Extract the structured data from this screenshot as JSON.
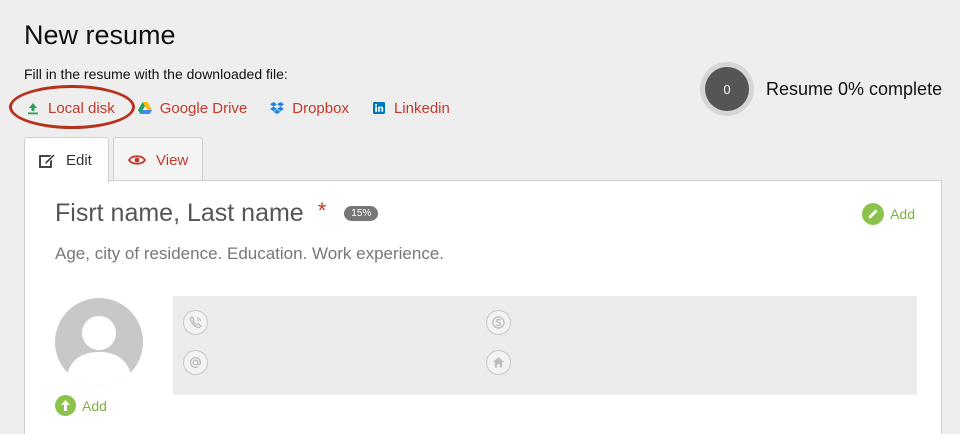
{
  "header": {
    "title": "New resume",
    "subtitle": "Fill in the resume with the downloaded file:"
  },
  "sources": [
    {
      "label": "Local disk",
      "icon": "upload-icon",
      "color": "#2e9e5b"
    },
    {
      "label": "Google Drive",
      "icon": "google-drive-icon"
    },
    {
      "label": "Dropbox",
      "icon": "dropbox-icon",
      "color": "#1e88e5"
    },
    {
      "label": "Linkedin",
      "icon": "linkedin-icon",
      "color": "#0077b5"
    }
  ],
  "progress": {
    "value": "0",
    "label": "Resume 0% complete"
  },
  "tabs": [
    {
      "label": "Edit",
      "icon": "edit-icon",
      "active": true
    },
    {
      "label": "View",
      "icon": "eye-icon",
      "active": false
    }
  ],
  "card": {
    "name_placeholder": "Fisrt name, Last name",
    "required_mark": "*",
    "percent_badge": "15%",
    "add_label": "Add",
    "description": "Age, city of residence. Education. Work experience.",
    "add_photo_label": "Add"
  },
  "contacts": [
    {
      "icon": "phone-icon"
    },
    {
      "icon": "skype-icon"
    },
    {
      "icon": "email-icon"
    },
    {
      "icon": "home-icon"
    }
  ],
  "colors": {
    "accent_red": "#c0392b",
    "accent_green": "#8bc34a",
    "highlight": "#b5321e"
  }
}
